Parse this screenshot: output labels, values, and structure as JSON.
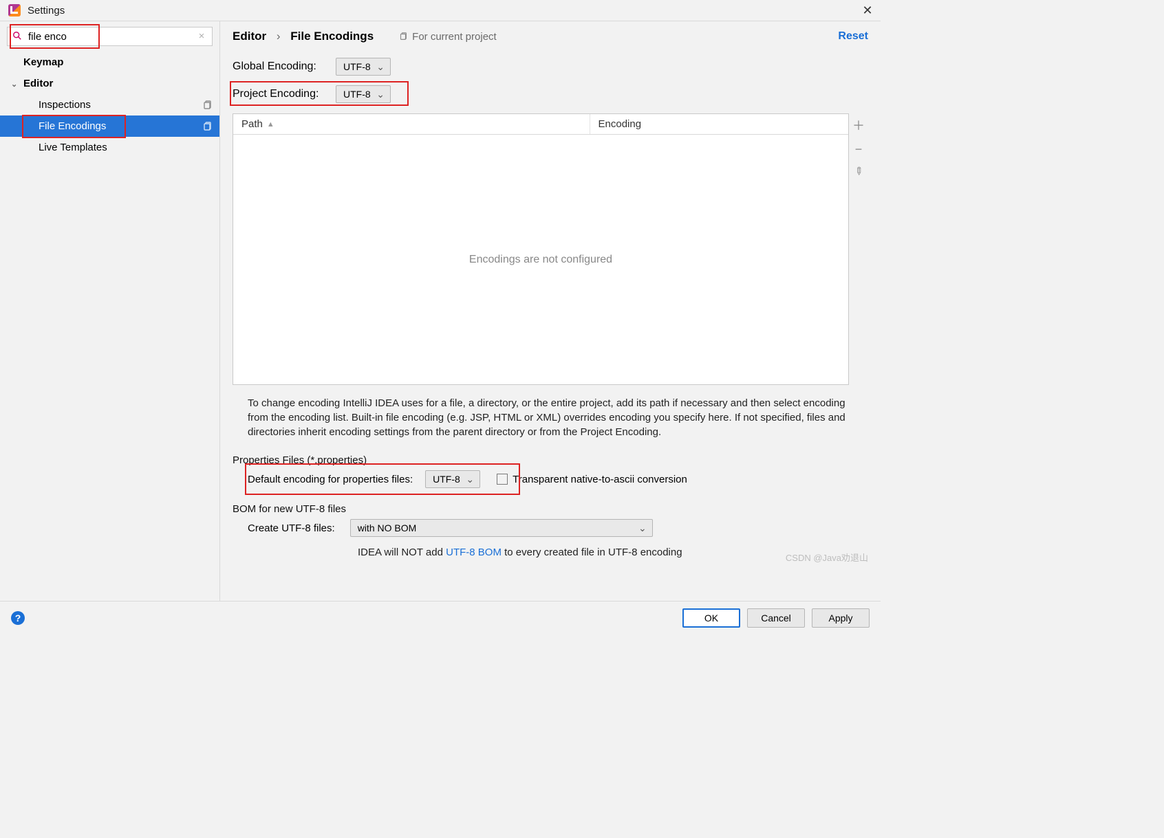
{
  "titlebar": {
    "title": "Settings"
  },
  "search": {
    "value": "file enco"
  },
  "tree": {
    "items": [
      {
        "label": "Keymap",
        "bold": true
      },
      {
        "label": "Editor",
        "bold": true,
        "expandable": true
      },
      {
        "label": "Inspections",
        "child": true,
        "copyable": true
      },
      {
        "label": "File Encodings",
        "child": true,
        "copyable": true,
        "selected": true
      },
      {
        "label": "Live Templates",
        "child": true
      }
    ]
  },
  "breadcrumb": {
    "root": "Editor",
    "leaf": "File Encodings"
  },
  "scope_badge": "For current project",
  "reset": "Reset",
  "rows": {
    "global_label": "Global Encoding:",
    "global_value": "UTF-8",
    "project_label": "Project Encoding:",
    "project_value": "UTF-8"
  },
  "table": {
    "col_path": "Path",
    "col_enc": "Encoding",
    "empty": "Encodings are not configured"
  },
  "note": "To change encoding IntelliJ IDEA uses for a file, a directory, or the entire project, add its path if necessary and then select encoding from the encoding list. Built-in file encoding (e.g. JSP, HTML or XML) overrides encoding you specify here. If not specified, files and directories inherit encoding settings from the parent directory or from the Project Encoding.",
  "props": {
    "section": "Properties Files (*.properties)",
    "default_label": "Default encoding for properties files:",
    "default_value": "UTF-8",
    "checkbox_label": "Transparent native-to-ascii conversion"
  },
  "bom": {
    "section": "BOM for new UTF-8 files",
    "create_label": "Create UTF-8 files:",
    "create_value": "with NO BOM",
    "hint_pre": "IDEA will NOT add ",
    "hint_link": "UTF-8 BOM",
    "hint_post": " to every created file in UTF-8 encoding"
  },
  "footer": {
    "ok": "OK",
    "cancel": "Cancel",
    "apply": "Apply"
  },
  "watermark": "CSDN @Java劝退山"
}
